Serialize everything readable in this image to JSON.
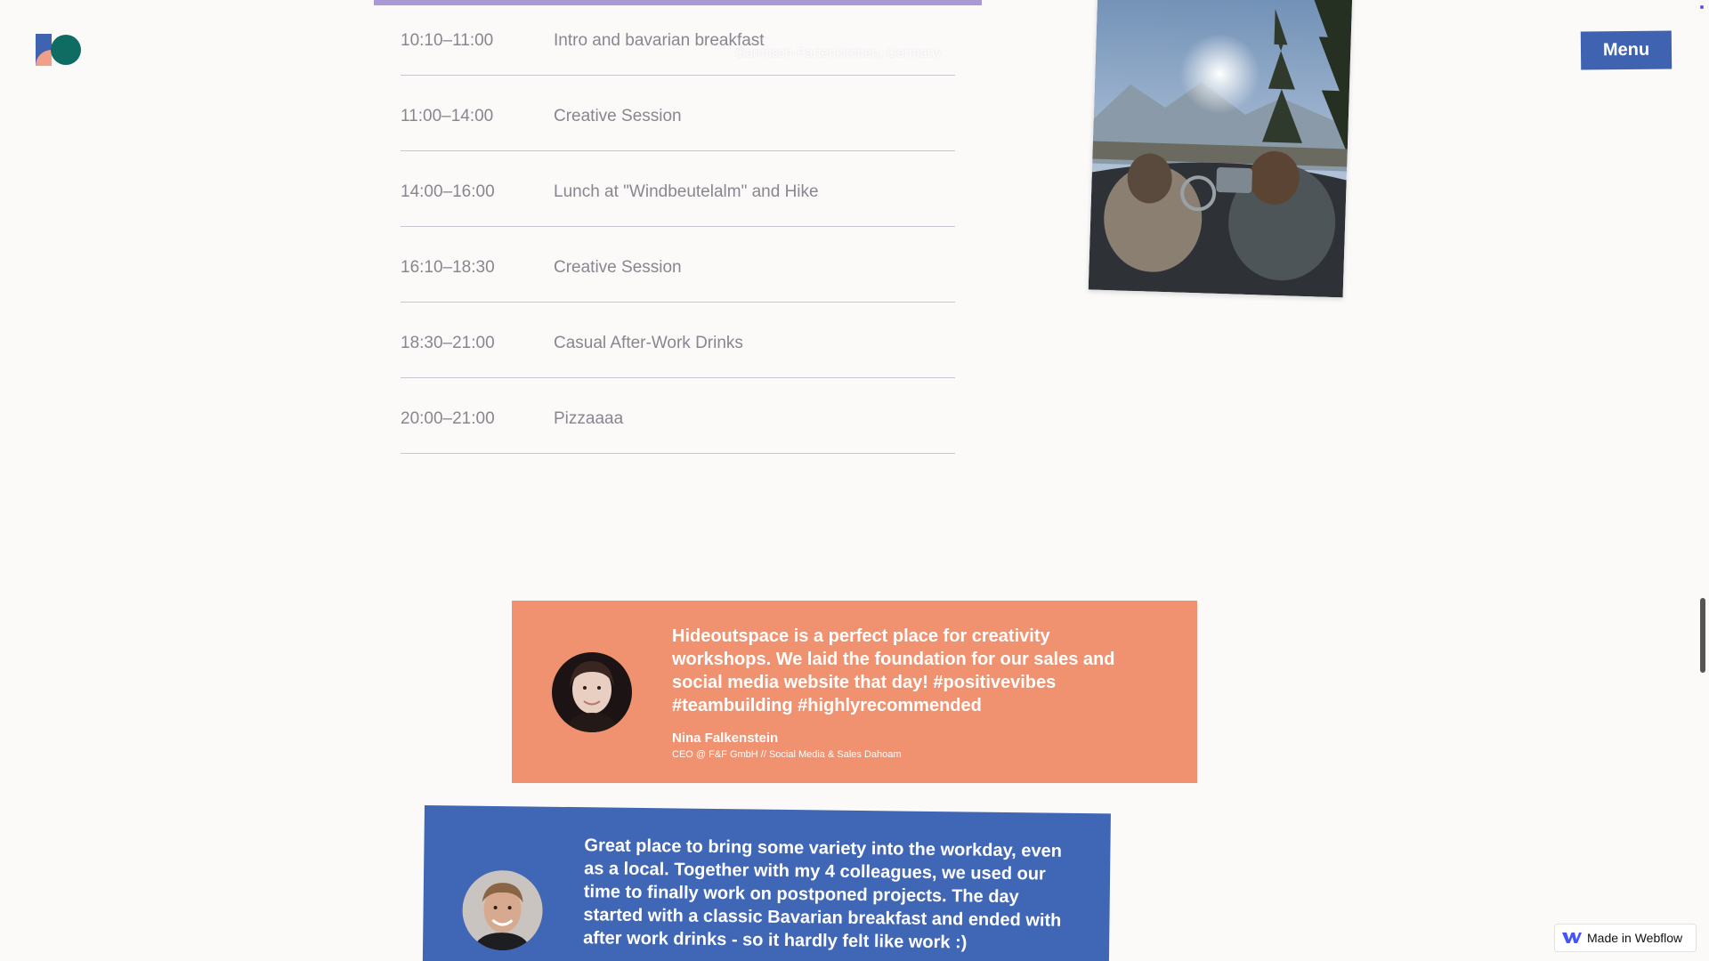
{
  "header": {
    "menu_label": "Menu"
  },
  "schedule": {
    "location": "Garmisch-Partenkirchen, Germany",
    "items": [
      {
        "time": "10:10–11:00",
        "title": "Intro and bavarian breakfast"
      },
      {
        "time": "11:00–14:00",
        "title": "Creative Session"
      },
      {
        "time": "14:00–16:00",
        "title": "Lunch at \"Windbeutelalm\" and Hike"
      },
      {
        "time": "16:10–18:30",
        "title": "Creative Session"
      },
      {
        "time": "18:30–21:00",
        "title": "Casual After-Work Drinks"
      },
      {
        "time": "20:00–21:00",
        "title": "Pizzaaaa"
      }
    ]
  },
  "testimonials": [
    {
      "quote": "Hideoutspace is a perfect place for creativity workshops. We laid the foundation for our sales and social media website that day! #positivevibes #teambuilding #highlyrecommended",
      "author": "Nina Falkenstein",
      "role": "CEO @ F&F GmbH // Social Media & Sales Dahoam",
      "color": "#f0916f"
    },
    {
      "quote": "Great place to bring some variety into the workday, even as a local. Together with my 4 colleagues, we used our time to finally work on postponed projects. The day started with a classic Bavarian breakfast and ended with after work drinks - so it hardly felt like work :)",
      "color": "#4066b6"
    }
  ],
  "badge": {
    "label": "Made in Webflow"
  },
  "colors": {
    "menu_bg": "#3f63b1",
    "accent_bar": "#a99ad6",
    "background": "#fbfaf9"
  }
}
